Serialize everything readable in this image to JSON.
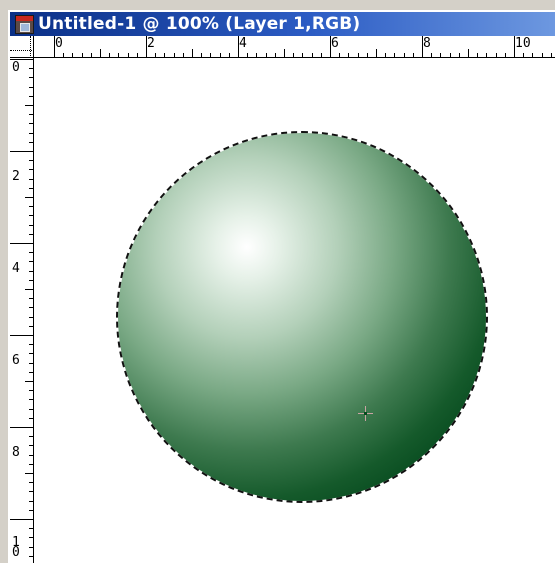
{
  "window": {
    "title": "Untitled-1 @ 100% (Layer 1,RGB)"
  },
  "icons": {
    "document": "photoshop-document-icon",
    "cursor": "crosshair-cursor-icon"
  },
  "rulers": {
    "unit": "cm",
    "top_labels": [
      "0",
      "2",
      "4",
      "6",
      "8",
      "10"
    ],
    "left_labels": [
      "0",
      "2",
      "4",
      "6",
      "8",
      "10"
    ]
  },
  "canvas": {
    "layer": "Layer 1",
    "mode": "RGB",
    "zoom": "100%",
    "background_color": "#ffffff",
    "shape": "sphere",
    "gradient_highlight_color": "#ffffff",
    "gradient_shadow_color": "#054a1d",
    "selection": "elliptical-marquee"
  }
}
